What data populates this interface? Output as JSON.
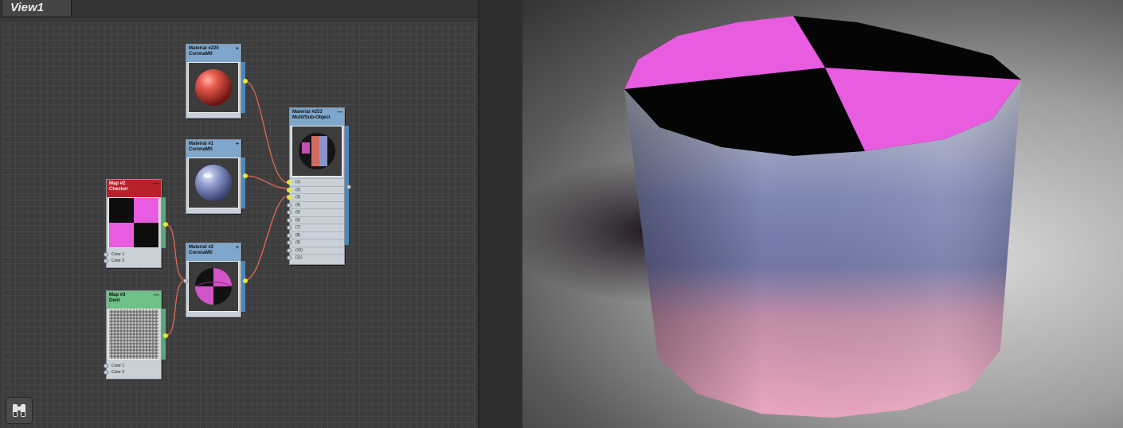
{
  "view": {
    "tab_label": "View1"
  },
  "nodes": {
    "mat220": {
      "title": "Material #220",
      "type": "CoronaMtl",
      "collapse": "+"
    },
    "mat1": {
      "title": "Material #1",
      "type": "CoronaMtl",
      "collapse": "+"
    },
    "mat2": {
      "title": "Material #2",
      "type": "CoronaMtl",
      "collapse": "+"
    },
    "mat253": {
      "title": "Material #253",
      "type": "Multi/Sub-Object",
      "collapse": "—",
      "slots": [
        "(1)",
        "(2)",
        "(3)",
        "(4)",
        "(5)",
        "(6)",
        "(7)",
        "(8)",
        "(9)",
        "(10)",
        "(11)"
      ]
    },
    "map2": {
      "title": "Map #2",
      "type": "Checker",
      "collapse": "—",
      "slots": [
        "Color 1",
        "Color 2"
      ]
    },
    "map3": {
      "title": "Map #3",
      "type": "Dent",
      "collapse": "—",
      "slots": [
        "Color 1",
        "Color 2"
      ]
    }
  },
  "icons": {
    "nav": "binoculars-icon"
  },
  "colors": {
    "accent_pink": "#e85ce0",
    "wire": "#e06a50",
    "port_out": "#e6e63a"
  }
}
